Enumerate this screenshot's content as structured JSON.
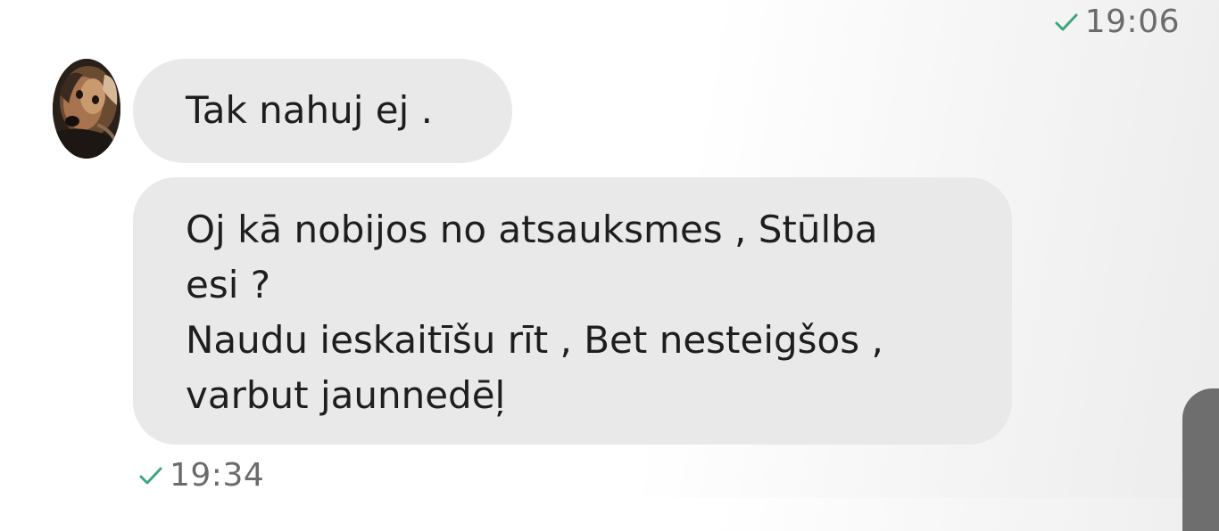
{
  "conversation": {
    "top_status": {
      "time": "19:06",
      "icon": "checkmark-icon",
      "color": "#3aa87a"
    },
    "messages": [
      {
        "text": "Tak nahuj ej ."
      },
      {
        "lines": [
          "Oj kā nobijos no atsauksmes , Stūlba",
          "esi ?",
          "Naudu ieskaitīšu rīt , Bet nesteigšos ,",
          "varbut jaunnedēļ"
        ]
      }
    ],
    "bottom_status": {
      "time": "19:34",
      "icon": "checkmark-icon",
      "color": "#3aa87a"
    },
    "sender_avatar": "dog-avatar-icon"
  }
}
